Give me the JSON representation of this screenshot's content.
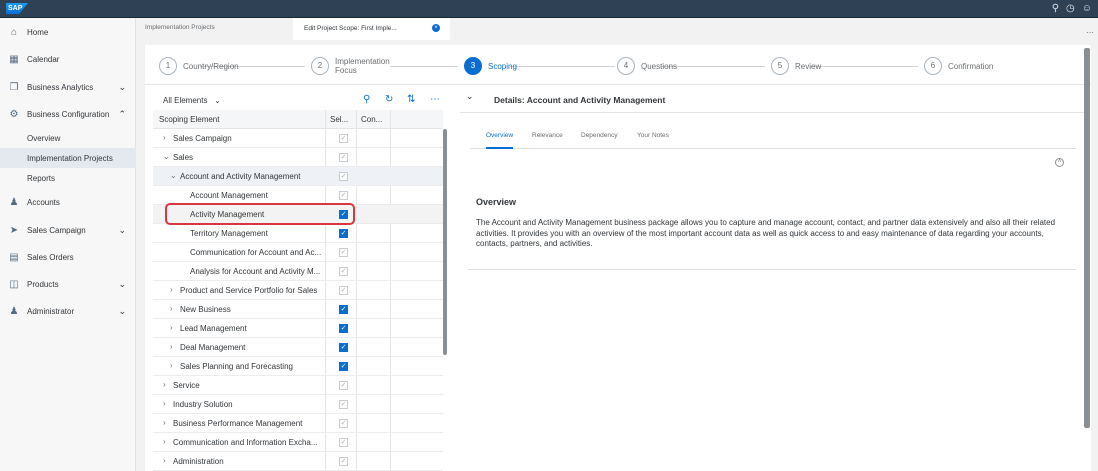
{
  "shell": {
    "logo": "SAP",
    "icons": [
      "search-icon",
      "clock-icon",
      "user-icon"
    ]
  },
  "sidebar": {
    "items": [
      {
        "label": "Home",
        "icon": "home-icon"
      },
      {
        "label": "Calendar",
        "icon": "calendar-icon"
      },
      {
        "label": "Business Analytics",
        "icon": "analytics-icon",
        "chevron": "down"
      },
      {
        "label": "Business Configuration",
        "icon": "configuration-icon",
        "chevron": "up"
      },
      {
        "label": "Overview",
        "sub": true
      },
      {
        "label": "Implementation Projects",
        "sub": true,
        "selected": true
      },
      {
        "label": "Reports",
        "sub": true
      },
      {
        "label": "Accounts",
        "icon": "accounts-icon"
      },
      {
        "label": "Sales Campaign",
        "icon": "campaign-icon",
        "chevron": "down"
      },
      {
        "label": "Sales Orders",
        "icon": "orders-icon"
      },
      {
        "label": "Products",
        "icon": "products-icon",
        "chevron": "down"
      },
      {
        "label": "Administrator",
        "icon": "administrator-icon",
        "chevron": "down"
      }
    ]
  },
  "tabs": {
    "inactive": "Implementation Projects",
    "active": "Edit Project Scope: First Imple..."
  },
  "stepper": [
    {
      "num": "1",
      "label": "Country/Region"
    },
    {
      "num": "2",
      "label": "Implementation Focus"
    },
    {
      "num": "3",
      "label": "Scoping",
      "active": true
    },
    {
      "num": "4",
      "label": "Questions"
    },
    {
      "num": "5",
      "label": "Review"
    },
    {
      "num": "6",
      "label": "Confirmation"
    }
  ],
  "left": {
    "filter": "All Elements",
    "columns": [
      "Scoping Element",
      "Sel...",
      "Con..."
    ],
    "rows": [
      {
        "label": "Sales Campaign",
        "level": 0,
        "exp": ">",
        "checked": "gray"
      },
      {
        "label": "Sales",
        "level": 0,
        "exp": "v",
        "checked": "gray"
      },
      {
        "label": "Account and Activity Management",
        "level": 1,
        "exp": "v",
        "checked": "gray",
        "highlight": true
      },
      {
        "label": "Account Management",
        "level": 2,
        "checked": "gray"
      },
      {
        "label": "Activity Management",
        "level": 2,
        "checked": "blue",
        "selected": true
      },
      {
        "label": "Territory Management",
        "level": 2,
        "checked": "blue"
      },
      {
        "label": "Communication for Account and Ac...",
        "level": 2,
        "checked": "gray"
      },
      {
        "label": "Analysis for Account and Activity M...",
        "level": 2,
        "checked": "gray"
      },
      {
        "label": "Product and Service Portfolio for Sales",
        "level": 1,
        "exp": ">",
        "checked": "gray"
      },
      {
        "label": "New Business",
        "level": 1,
        "exp": ">",
        "checked": "blue"
      },
      {
        "label": "Lead Management",
        "level": 1,
        "exp": ">",
        "checked": "blue"
      },
      {
        "label": "Deal Management",
        "level": 1,
        "exp": ">",
        "checked": "blue"
      },
      {
        "label": "Sales Planning and Forecasting",
        "level": 1,
        "exp": ">",
        "checked": "blue"
      },
      {
        "label": "Service",
        "level": 0,
        "exp": ">",
        "checked": "gray"
      },
      {
        "label": "Industry Solution",
        "level": 0,
        "exp": ">",
        "checked": "gray"
      },
      {
        "label": "Business Performance Management",
        "level": 0,
        "exp": ">",
        "checked": "gray"
      },
      {
        "label": "Communication and Information Excha...",
        "level": 0,
        "exp": ">",
        "checked": "gray"
      },
      {
        "label": "Administration",
        "level": 0,
        "exp": ">",
        "checked": "gray"
      }
    ]
  },
  "details": {
    "title": "Details: Account and Activity Management",
    "tabs": [
      "Overview",
      "Relevance",
      "Dependency",
      "Your Notes"
    ],
    "heading": "Overview",
    "text": "The Account and Activity Management business package allows you to capture and manage account, contact, and partner data extensively and also all their related activities. It provides you with an overview of the most important account data as well as quick access to and easy maintenance of data regarding your accounts, contacts, partners, and activities."
  },
  "colors": {
    "accent": "#0a6ed1",
    "shell": "#2f4154",
    "highlight": "#d9363e"
  }
}
